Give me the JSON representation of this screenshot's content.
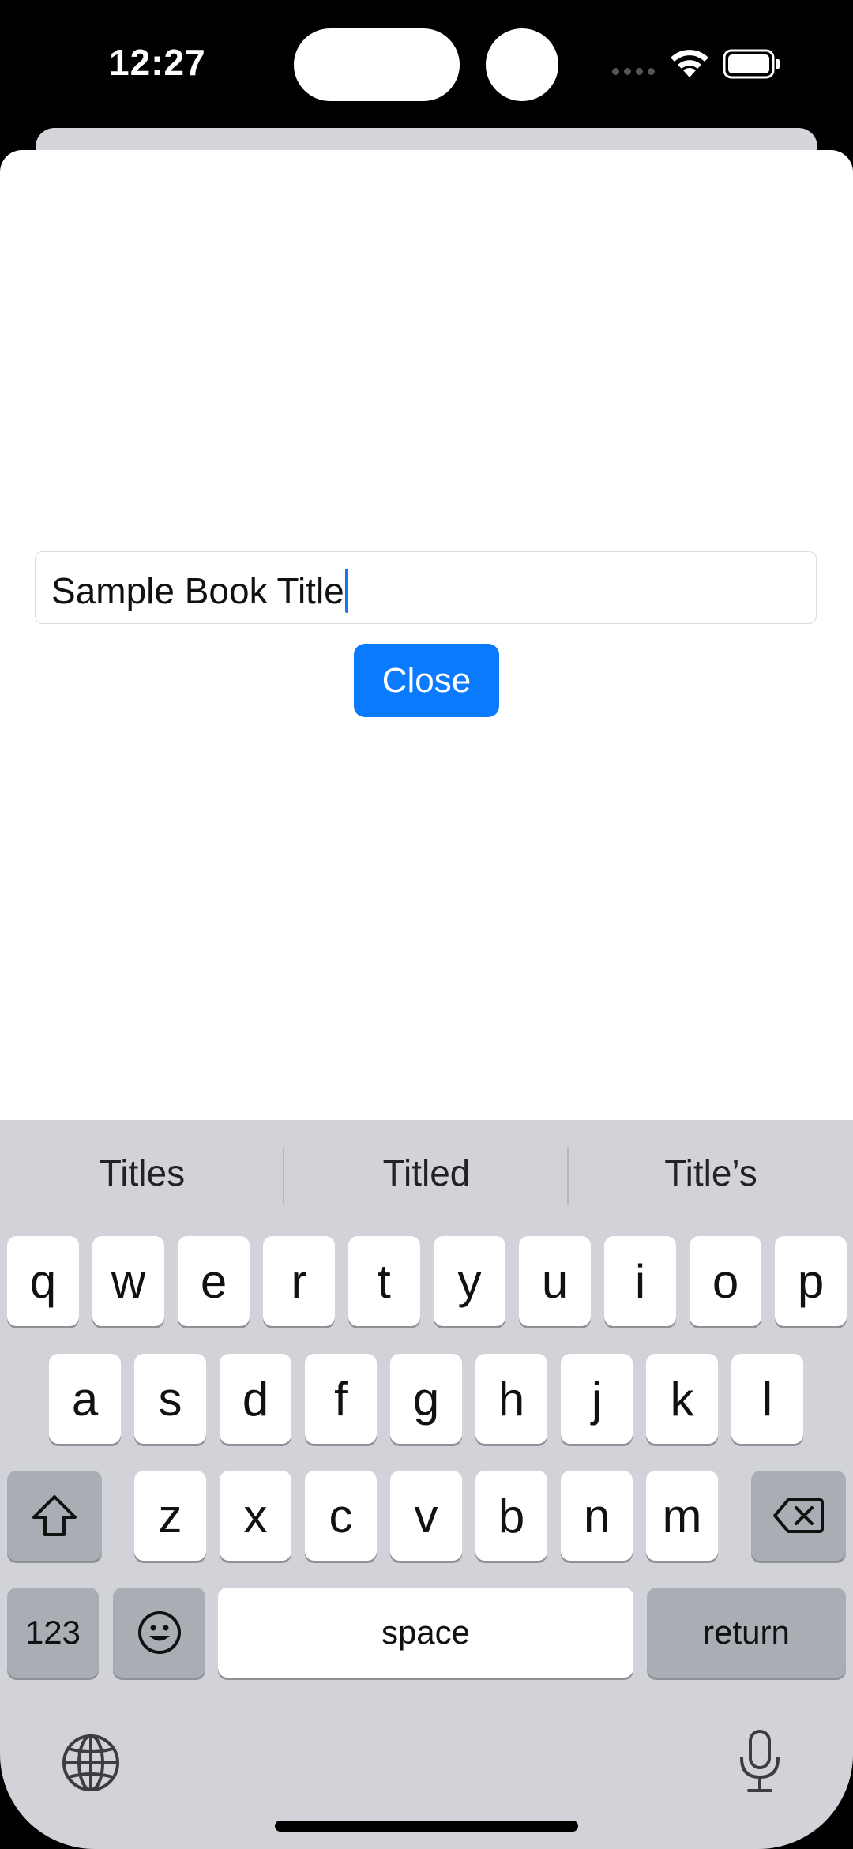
{
  "status_bar": {
    "time": "12:27"
  },
  "form": {
    "title_value": "Sample Book Title",
    "close_label": "Close"
  },
  "keyboard": {
    "suggestions": [
      "Titles",
      "Titled",
      "Title’s"
    ],
    "row1": [
      "q",
      "w",
      "e",
      "r",
      "t",
      "y",
      "u",
      "i",
      "o",
      "p"
    ],
    "row2": [
      "a",
      "s",
      "d",
      "f",
      "g",
      "h",
      "j",
      "k",
      "l"
    ],
    "row3": [
      "z",
      "x",
      "c",
      "v",
      "b",
      "n",
      "m"
    ],
    "numbers_label": "123",
    "space_label": "space",
    "return_label": "return"
  },
  "colors": {
    "accent": "#0a7aff",
    "keyboard_bg": "#d1d3d8",
    "key_dark": "#a9adb4"
  },
  "icons": [
    "wifi-icon",
    "battery-icon",
    "shift-icon",
    "backspace-icon",
    "emoji-icon",
    "globe-icon",
    "microphone-icon"
  ]
}
